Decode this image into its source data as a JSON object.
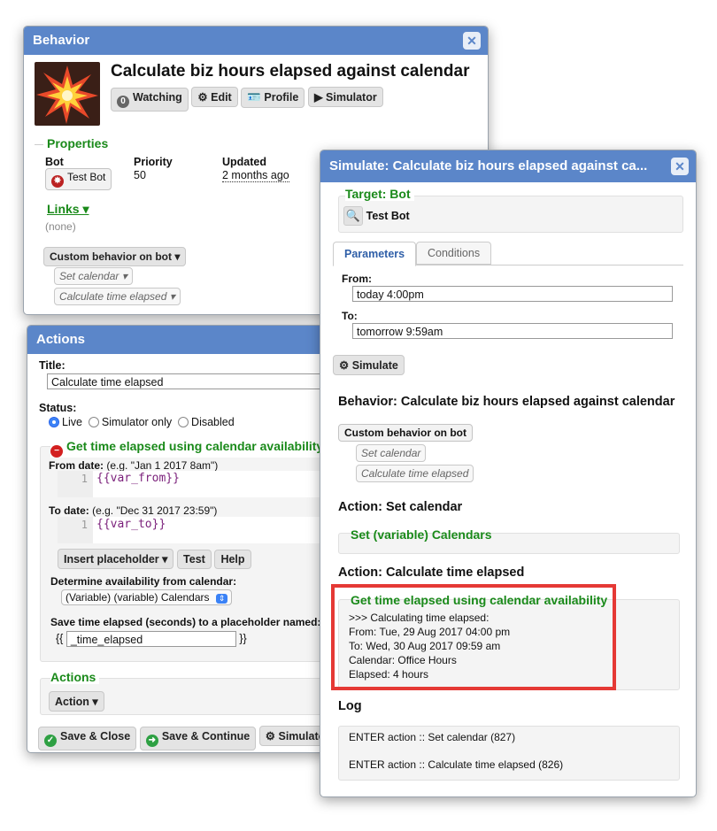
{
  "behavior": {
    "window_title": "Behavior",
    "heading": "Calculate biz hours elapsed against calendar",
    "toolbar": {
      "watch_count": "0",
      "watching": "Watching",
      "edit": "Edit",
      "profile": "Profile",
      "simulator": "Simulator"
    },
    "properties_title": "Properties",
    "bot_label": "Bot",
    "bot_value": "Test Bot",
    "priority_label": "Priority",
    "priority_value": "50",
    "updated_label": "Updated",
    "updated_value": "2 months ago",
    "links_label": "Links ▾",
    "links_value": "(none)",
    "custom_behavior": "Custom behavior on bot ▾",
    "action1": "Set calendar ▾",
    "action2": "Calculate time elapsed ▾"
  },
  "actions": {
    "window_title": "Actions",
    "title_label": "Title:",
    "title_value": "Calculate time elapsed",
    "status_label": "Status:",
    "status_live": "Live",
    "status_sim": "Simulator only",
    "status_disabled": "Disabled",
    "section_title": "Get time elapsed using calendar availability",
    "from_label": "From date:",
    "from_hint": "(e.g. \"Jan 1 2017 8am\")",
    "from_line": "1",
    "from_code": "{{var_from}}",
    "to_label": "To date:",
    "to_hint": "(e.g. \"Dec 31 2017 23:59\")",
    "to_line": "1",
    "to_code": "{{var_to}}",
    "insert_placeholder": "Insert placeholder ▾",
    "test": "Test",
    "help": "Help",
    "availability_label": "Determine availability from calendar:",
    "availability_value": "(Variable) (variable) Calendars",
    "save_label": "Save time elapsed (seconds) to a placeholder named:",
    "save_open": "{{",
    "save_value": "_time_elapsed",
    "save_close": "}}",
    "actions_title": "Actions",
    "action_menu": "Action ▾",
    "save_close_btn": "Save & Close",
    "save_continue_btn": "Save & Continue",
    "simulator_btn": "Simulator"
  },
  "simulate": {
    "window_title": "Simulate: Calculate biz hours elapsed against ca...",
    "target_title": "Target: Bot",
    "target_value": "Test Bot",
    "tabs": [
      "Parameters",
      "Conditions"
    ],
    "from_label": "From:",
    "from_value": "today 4:00pm",
    "to_label": "To:",
    "to_value": "tomorrow 9:59am",
    "simulate_btn": "Simulate",
    "behavior_heading": "Behavior: Calculate biz hours elapsed against calendar",
    "custom_behavior": "Custom behavior on bot",
    "action1": "Set calendar",
    "action2": "Calculate time elapsed",
    "action_set_heading": "Action: Set calendar",
    "set_var_title": "Set (variable) Calendars",
    "action_calc_heading": "Action: Calculate time elapsed",
    "result_title": "Get time elapsed using calendar availability",
    "result_lines": [
      ">>> Calculating time elapsed:",
      "From: Tue, 29 Aug 2017 04:00 pm",
      "To: Wed, 30 Aug 2017 09:59 am",
      "Calendar: Office Hours",
      "Elapsed: 4 hours"
    ],
    "log_heading": "Log",
    "log_lines": [
      "ENTER action :: Set calendar (827)",
      "ENTER action :: Calculate time elapsed (826)"
    ]
  },
  "colors": {
    "titlebar": "#5b86c9",
    "green": "#1a8a1a",
    "highlight": "#e53935"
  }
}
